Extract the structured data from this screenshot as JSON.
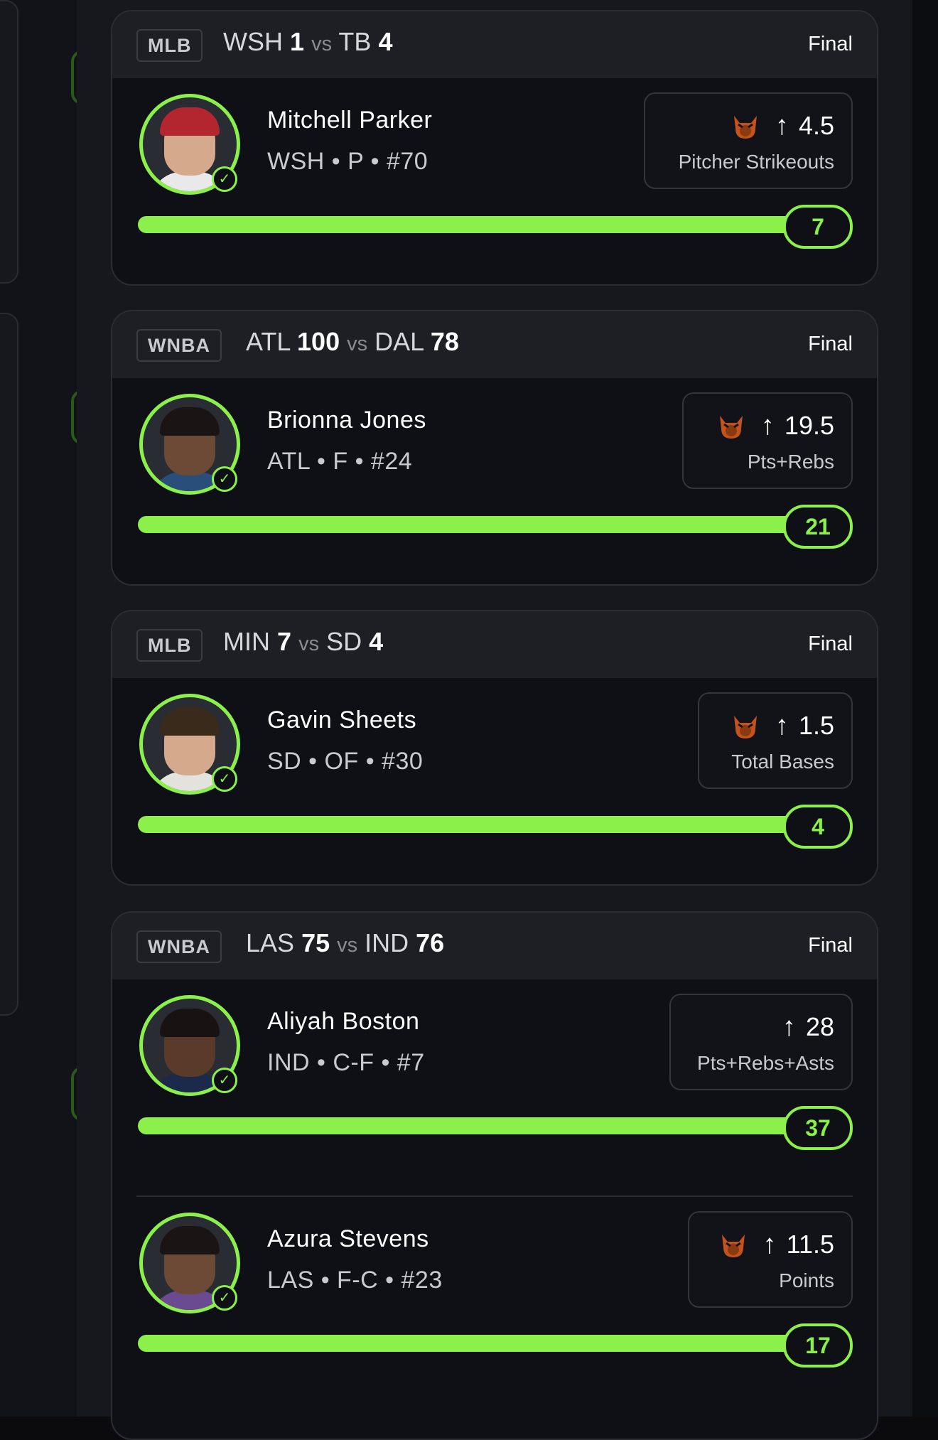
{
  "colors": {
    "accent": "#8cf04a",
    "card_bg": "#0f1015",
    "header_bg": "#1d1f25"
  },
  "games": [
    {
      "league": "MLB",
      "team_a": "WSH",
      "score_a": "1",
      "vs": "vs",
      "team_b": "TB",
      "score_b": "4",
      "status": "Final",
      "picks": [
        {
          "name": "Mitchell Parker",
          "meta": "WSH • P • #70",
          "direction_icon": "arrow-up-icon",
          "has_demon": true,
          "line": "4.5",
          "stat": "Pitcher Strikeouts",
          "result": "7",
          "progress": 1.0
        }
      ]
    },
    {
      "league": "WNBA",
      "team_a": "ATL",
      "score_a": "100",
      "vs": "vs",
      "team_b": "DAL",
      "score_b": "78",
      "status": "Final",
      "picks": [
        {
          "name": "Brionna Jones",
          "meta": "ATL • F • #24",
          "direction_icon": "arrow-up-icon",
          "has_demon": true,
          "line": "19.5",
          "stat": "Pts+Rebs",
          "result": "21",
          "progress": 1.0
        }
      ]
    },
    {
      "league": "MLB",
      "team_a": "MIN",
      "score_a": "7",
      "vs": "vs",
      "team_b": "SD",
      "score_b": "4",
      "status": "Final",
      "picks": [
        {
          "name": "Gavin Sheets",
          "meta": "SD • OF • #30",
          "direction_icon": "arrow-up-icon",
          "has_demon": true,
          "line": "1.5",
          "stat": "Total Bases",
          "result": "4",
          "progress": 1.0
        }
      ]
    },
    {
      "league": "WNBA",
      "team_a": "LAS",
      "score_a": "75",
      "vs": "vs",
      "team_b": "IND",
      "score_b": "76",
      "status": "Final",
      "picks": [
        {
          "name": "Aliyah Boston",
          "meta": "IND • C-F • #7",
          "direction_icon": "arrow-up-icon",
          "has_demon": false,
          "line": "28",
          "stat": "Pts+Rebs+Asts",
          "result": "37",
          "progress": 1.0
        },
        {
          "name": "Azura Stevens",
          "meta": "LAS • F-C • #23",
          "direction_icon": "arrow-up-icon",
          "has_demon": true,
          "line": "11.5",
          "stat": "Points",
          "result": "17",
          "progress": 1.0
        }
      ]
    }
  ]
}
